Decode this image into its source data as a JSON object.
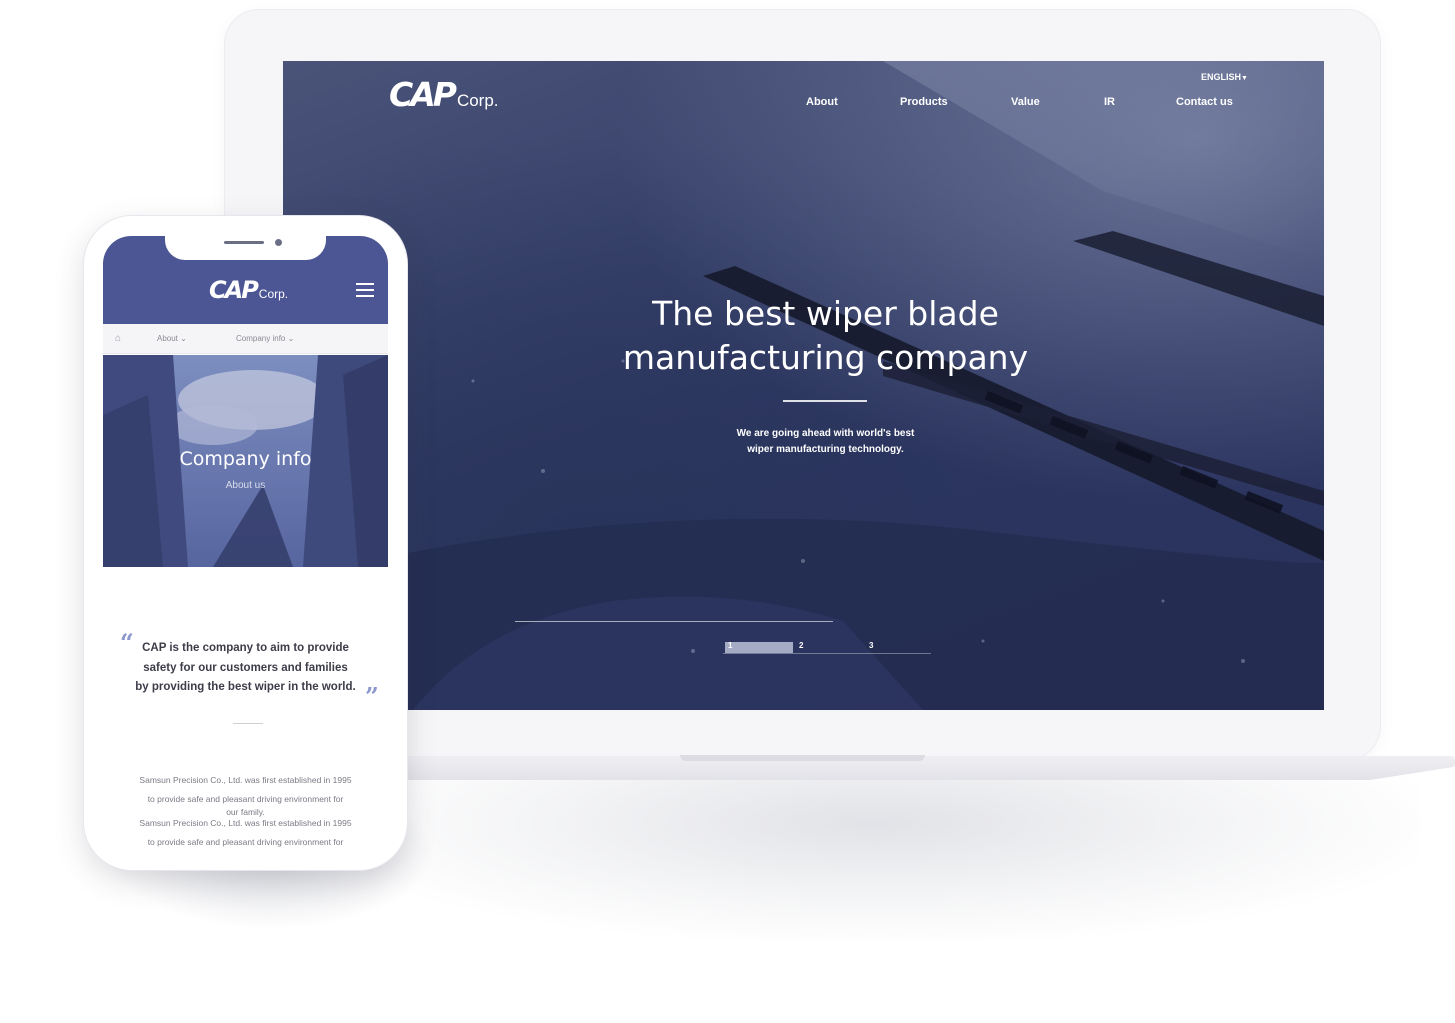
{
  "desktop": {
    "logo": {
      "mark": "CAP",
      "suffix": "Corp."
    },
    "language": "ENGLISH",
    "nav": [
      "About",
      "Products",
      "Value",
      "IR",
      "Contact us"
    ],
    "hero": {
      "title_line1": "The best wiper blade",
      "title_line2": "manufacturing company",
      "sub_line1": "We are going ahead with world's best",
      "sub_line2": "wiper manufacturing technology."
    },
    "pager": {
      "pages": [
        "1",
        "2",
        "3"
      ],
      "active": "1"
    }
  },
  "mobile": {
    "logo": {
      "mark": "CAP",
      "suffix": "Corp."
    },
    "breadcrumb": [
      "About",
      "Company info"
    ],
    "banner": {
      "title": "Company info",
      "subtitle": "About us"
    },
    "quote": {
      "line1": "CAP is the company to aim to provide",
      "line2": "safety for our customers and families",
      "line3": "by providing the best wiper in the world."
    },
    "body": {
      "p1_line1": "Samsun Precision Co., Ltd. was first established in 1995",
      "p1_line2": "to provide safe and pleasant driving environment for",
      "p1_line3": "our family.",
      "p2_line1": "Samsun Precision Co., Ltd. was first established in 1995",
      "p2_line2": "to provide safe and pleasant driving environment for"
    }
  },
  "colors": {
    "brand_navy": "#4c5695",
    "hero_overlay": "#2c3561",
    "quote_mark": "#8d98cf"
  },
  "icons": [
    "home-icon",
    "hamburger-menu-icon",
    "caret-down-icon",
    "quote-open-icon",
    "quote-close-icon"
  ]
}
